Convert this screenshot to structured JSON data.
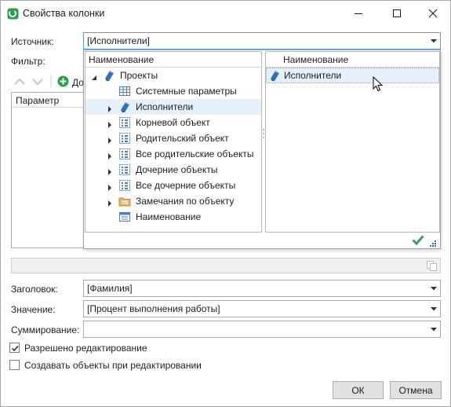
{
  "window": {
    "title": "Свойства колонки",
    "app_icon": "app-logo-icon",
    "controls": [
      "minimize-icon",
      "maximize-icon",
      "close-icon"
    ]
  },
  "form": {
    "source_label": "Источник:",
    "source_value": "[Исполнители]",
    "filter_label": "Фильтр:",
    "add_label": "До",
    "param_header": "Параметр",
    "header_label": "Заголовок:",
    "header_value": "[Фамилия]",
    "value_label": "Значение:",
    "value_value": "[Процент выполнения работы]",
    "summation_label": "Суммирование:",
    "summation_value": "",
    "edit_allowed_label": "Разрешено редактирование",
    "edit_allowed_checked": true,
    "create_objects_label": "Создавать объекты при редактировании",
    "create_objects_checked": false
  },
  "popup": {
    "tree_header": "Наименование",
    "tree": [
      {
        "label": "Проекты",
        "icon": "project-icon",
        "level": 0,
        "expander": "expanded"
      },
      {
        "label": "Системные параметры",
        "icon": "table-icon",
        "level": 1,
        "expander": "none"
      },
      {
        "label": "Исполнители",
        "icon": "project-icon",
        "level": 1,
        "expander": "collapsed",
        "selected": true
      },
      {
        "label": "Корневой объект",
        "icon": "object-grid-icon",
        "level": 1,
        "expander": "collapsed"
      },
      {
        "label": "Родительский объект",
        "icon": "object-grid-icon",
        "level": 1,
        "expander": "collapsed"
      },
      {
        "label": "Все родительские объекты",
        "icon": "object-grid-icon",
        "level": 1,
        "expander": "collapsed"
      },
      {
        "label": "Дочерние объекты",
        "icon": "object-grid-icon",
        "level": 1,
        "expander": "collapsed"
      },
      {
        "label": "Все дочерние объекты",
        "icon": "object-grid-icon",
        "level": 1,
        "expander": "collapsed"
      },
      {
        "label": "Замечания по объекту",
        "icon": "folder-notes-icon",
        "level": 1,
        "expander": "collapsed"
      },
      {
        "label": "Наименование",
        "icon": "field-icon",
        "level": 1,
        "expander": "none"
      }
    ],
    "list_header": "Наименование",
    "list": [
      {
        "label": "Исполнители",
        "icon": "project-icon",
        "selected": true
      }
    ]
  },
  "buttons": {
    "ok": "ОК",
    "cancel": "Отмена"
  },
  "colors": {
    "accent_blue": "#569de5",
    "selection": "#e5f0fb",
    "ok_green": "#3aa05a",
    "app_green": "#2e9c48"
  }
}
